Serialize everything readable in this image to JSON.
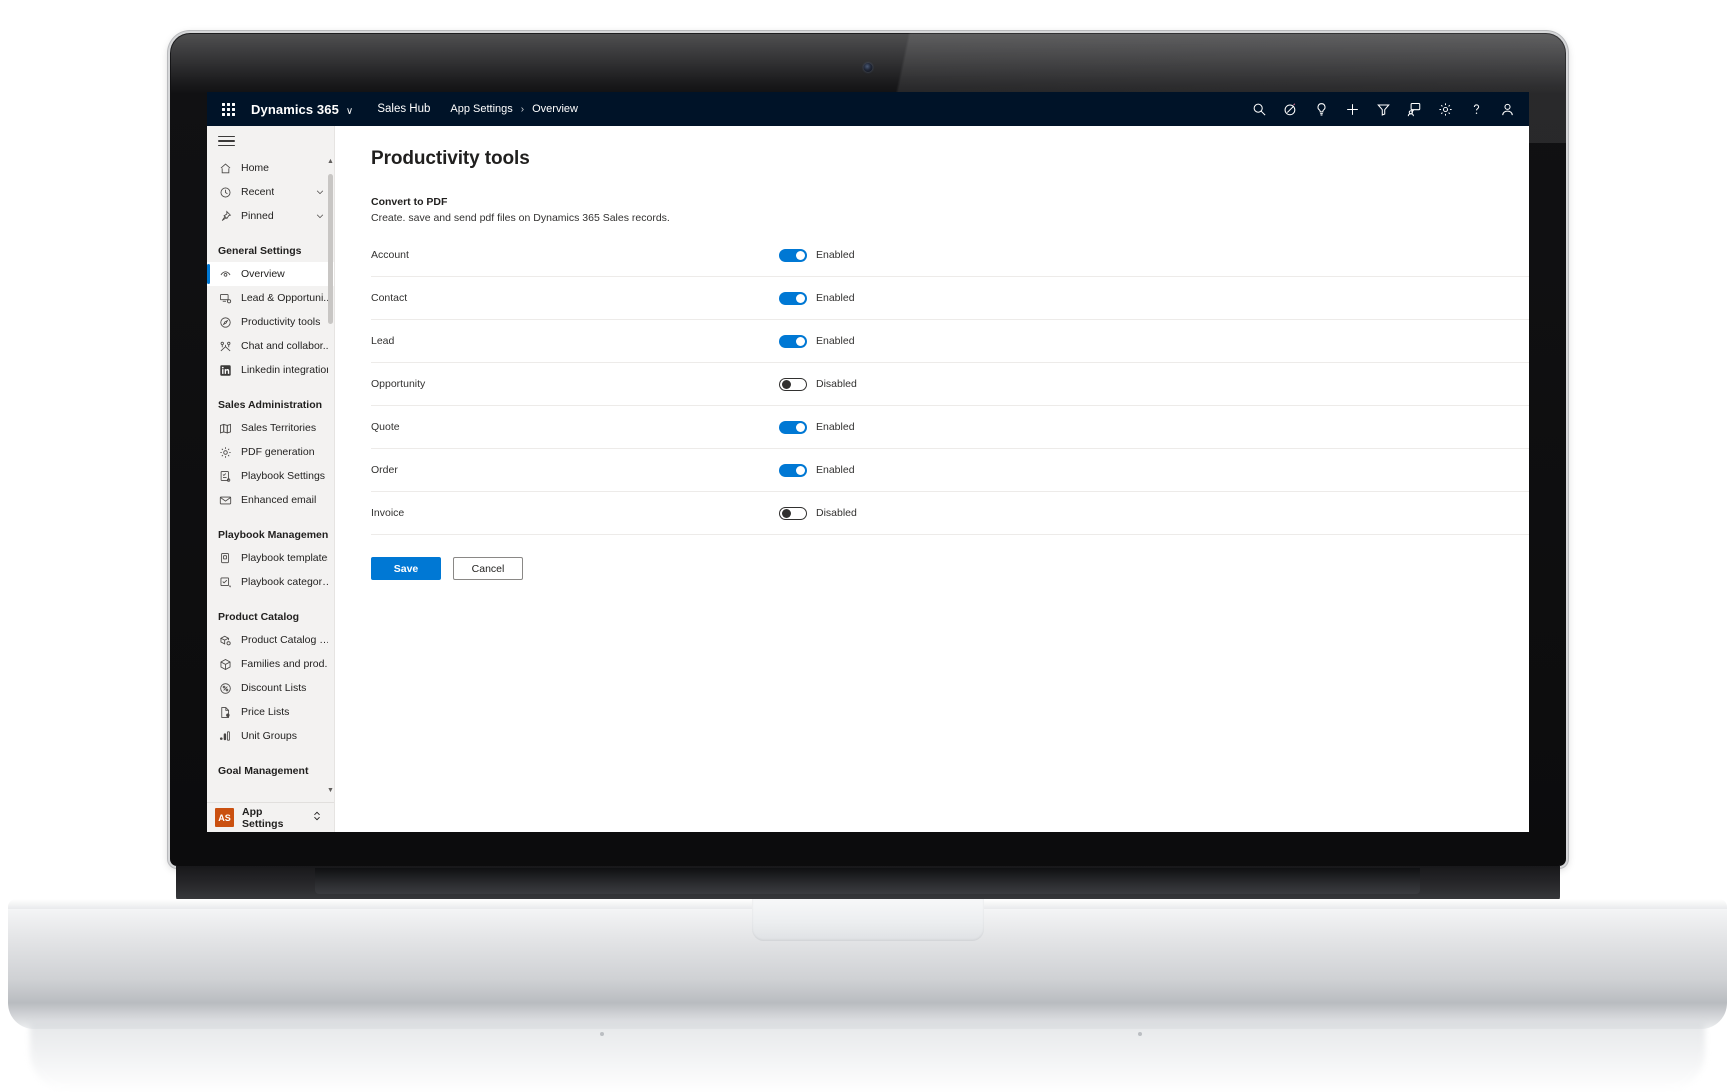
{
  "header": {
    "waffle_icon": "app-launcher-icon",
    "brand": "Dynamics 365",
    "brand_chevron": "∨",
    "app_name": "Sales Hub",
    "breadcrumb": [
      {
        "label": "App Settings"
      },
      {
        "label": "Overview"
      }
    ],
    "breadcrumb_separator": "›",
    "icons": [
      {
        "name": "search-icon",
        "title": "Search"
      },
      {
        "name": "diagnostics-icon",
        "title": "Diagnostics"
      },
      {
        "name": "lightbulb-icon",
        "title": "Insights"
      },
      {
        "name": "plus-icon",
        "title": "Quick create"
      },
      {
        "name": "filter-icon",
        "title": "Filter"
      },
      {
        "name": "assistant-icon",
        "title": "Relationship assistant"
      },
      {
        "name": "gear-icon",
        "title": "Settings"
      },
      {
        "name": "help-icon",
        "title": "Help"
      },
      {
        "name": "user-icon",
        "title": "Account manager"
      }
    ]
  },
  "sidebar": {
    "hamburger_icon": "hamburger-icon",
    "quick": [
      {
        "label": "Home",
        "icon": "home-icon",
        "chevron": false
      },
      {
        "label": "Recent",
        "icon": "clock-icon",
        "chevron": true
      },
      {
        "label": "Pinned",
        "icon": "pin-icon",
        "chevron": true
      }
    ],
    "groups": [
      {
        "title": "General Settings",
        "items": [
          {
            "label": "Overview",
            "icon": "overview-icon",
            "selected": true
          },
          {
            "label": "Lead & Opportuni...",
            "icon": "lead-opportunity-icon",
            "selected": false
          },
          {
            "label": "Productivity tools",
            "icon": "productivity-icon",
            "selected": false
          },
          {
            "label": "Chat and collabor...",
            "icon": "chat-collaboration-icon",
            "selected": false
          },
          {
            "label": "Linkedin integration",
            "icon": "linkedin-icon",
            "selected": false
          }
        ]
      },
      {
        "title": "Sales Administration",
        "items": [
          {
            "label": "Sales Territories",
            "icon": "territories-icon",
            "selected": false
          },
          {
            "label": "PDF generation",
            "icon": "gear-icon",
            "selected": false
          },
          {
            "label": "Playbook Settings",
            "icon": "playbook-settings-icon",
            "selected": false
          },
          {
            "label": "Enhanced email",
            "icon": "mail-icon",
            "selected": false
          }
        ]
      },
      {
        "title": "Playbook Management",
        "items": [
          {
            "label": "Playbook templates",
            "icon": "template-icon",
            "selected": false
          },
          {
            "label": "Playbook categories",
            "icon": "category-icon",
            "selected": false
          }
        ]
      },
      {
        "title": "Product Catalog",
        "items": [
          {
            "label": "Product Catalog S...",
            "icon": "catalog-settings-icon",
            "selected": false
          },
          {
            "label": "Families and prod...",
            "icon": "box-icon",
            "selected": false
          },
          {
            "label": "Discount Lists",
            "icon": "percent-icon",
            "selected": false
          },
          {
            "label": "Price Lists",
            "icon": "price-list-icon",
            "selected": false
          },
          {
            "label": "Unit Groups",
            "icon": "unit-groups-icon",
            "selected": false
          }
        ]
      },
      {
        "title": "Goal Management",
        "items": []
      }
    ],
    "area_switcher": {
      "badge": "AS",
      "label": "App Settings",
      "chevron_icon": "chevron-up-down-icon"
    }
  },
  "main": {
    "page_title": "Productivity tools",
    "section": {
      "title": "Convert to PDF",
      "description": "Create. save and send pdf files on Dynamics 365 Sales records."
    },
    "rows": [
      {
        "label": "Account",
        "enabled": true,
        "state_text": "Enabled"
      },
      {
        "label": "Contact",
        "enabled": true,
        "state_text": "Enabled"
      },
      {
        "label": "Lead",
        "enabled": true,
        "state_text": "Enabled"
      },
      {
        "label": "Opportunity",
        "enabled": false,
        "state_text": "Disabled"
      },
      {
        "label": "Quote",
        "enabled": true,
        "state_text": "Enabled"
      },
      {
        "label": "Order",
        "enabled": true,
        "state_text": "Enabled"
      },
      {
        "label": "Invoice",
        "enabled": false,
        "state_text": "Disabled"
      }
    ],
    "buttons": {
      "save": "Save",
      "cancel": "Cancel"
    }
  },
  "colors": {
    "header_bg": "#001328",
    "accent": "#0078d4",
    "sidebar_bg": "#f3f2f1",
    "area_badge": "#ca5010"
  }
}
